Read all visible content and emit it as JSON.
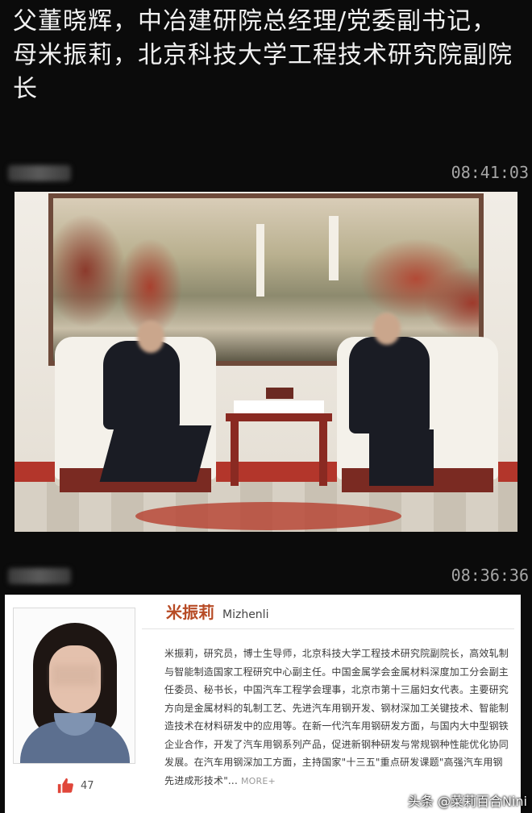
{
  "caption": "父董晓辉，中冶建研院总经理/党委副书记，母米振莉，北京科技大学工程技术研究院副院长",
  "messages": [
    {
      "timestamp": "08:41:03"
    },
    {
      "timestamp": "08:36:36"
    }
  ],
  "profile": {
    "name_cn": "米振莉",
    "name_en": "Mizhenli",
    "bio": "米振莉，研究员，博士生导师，北京科技大学工程技术研究院副院长，高效轧制与智能制造国家工程研究中心副主任。中国金属学会金属材料深度加工分会副主任委员、秘书长，中国汽车工程学会理事，北京市第十三届妇女代表。主要研究方向是金属材料的轧制工艺、先进汽车用钢开发、钢材深加工关键技术、智能制造技术在材料研发中的应用等。在新一代汽车用钢研发方面，与国内大中型钢铁企业合作，开发了汽车用钢系列产品，促进新钢种研发与常规钢种性能优化协同发展。在汽车用钢深加工方面，主持国家\"十三五\"重点研发课题\"高强汽车用钢先进成形技术\"...",
    "more_label": "MORE+",
    "likes": "47"
  },
  "watermark": "头条 @菜莉百合Nini"
}
